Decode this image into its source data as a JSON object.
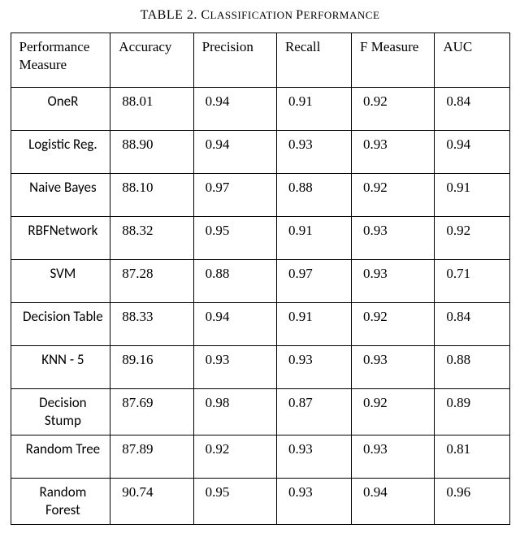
{
  "caption": {
    "prefix": "TABLE 2. C",
    "rest": "LASSIFICATION ",
    "prefix2": "P",
    "rest2": "ERFORMANCE"
  },
  "chart_data": {
    "type": "table",
    "title": "Classification Performance",
    "columns": [
      "Performance Measure",
      "Accuracy",
      "Precision",
      "Recall",
      "F Measure",
      "AUC"
    ],
    "rows": [
      {
        "name": "OneR",
        "accuracy": "88.01",
        "precision": "0.94",
        "recall": "0.91",
        "f": "0.92",
        "auc": "0.84"
      },
      {
        "name": "Logistic Reg.",
        "accuracy": "88.90",
        "precision": "0.94",
        "recall": "0.93",
        "f": "0.93",
        "auc": "0.94"
      },
      {
        "name": "Naive Bayes",
        "accuracy": "88.10",
        "precision": "0.97",
        "recall": "0.88",
        "f": "0.92",
        "auc": "0.91"
      },
      {
        "name": "RBFNetwork",
        "accuracy": "88.32",
        "precision": "0.95",
        "recall": "0.91",
        "f": "0.93",
        "auc": "0.92"
      },
      {
        "name": "SVM",
        "accuracy": "87.28",
        "precision": "0.88",
        "recall": "0.97",
        "f": "0.93",
        "auc": "0.71"
      },
      {
        "name": "Decision Table",
        "accuracy": "88.33",
        "precision": "0.94",
        "recall": "0.91",
        "f": "0.92",
        "auc": "0.84"
      },
      {
        "name": "KNN - 5",
        "accuracy": "89.16",
        "precision": "0.93",
        "recall": "0.93",
        "f": "0.93",
        "auc": "0.88"
      },
      {
        "name": "Decision Stump",
        "accuracy": "87.69",
        "precision": "0.98",
        "recall": "0.87",
        "f": "0.92",
        "auc": "0.89"
      },
      {
        "name": "Random Tree",
        "accuracy": "87.89",
        "precision": "0.92",
        "recall": "0.93",
        "f": "0.93",
        "auc": "0.81"
      },
      {
        "name": "Random Forest",
        "accuracy": "90.74",
        "precision": "0.95",
        "recall": "0.93",
        "f": "0.94",
        "auc": "0.96"
      }
    ]
  }
}
